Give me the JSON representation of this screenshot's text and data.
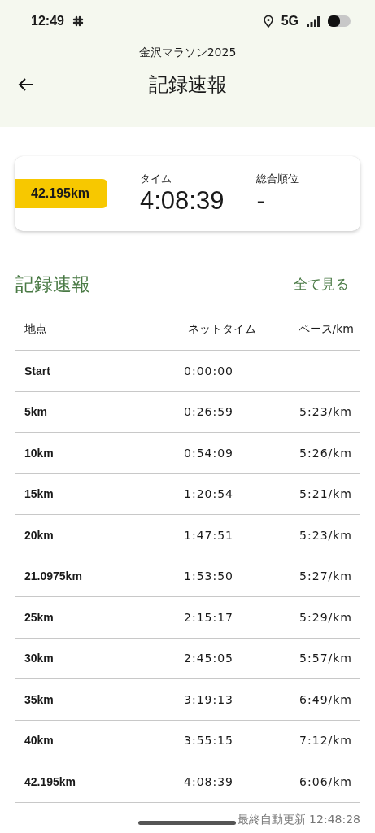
{
  "status_bar": {
    "time": "12:49",
    "network": "5G"
  },
  "header": {
    "subtitle": "金沢マラソン2025",
    "title": "記録速報"
  },
  "summary": {
    "distance": "42.195km",
    "time_label": "タイム",
    "time": "4:08:39",
    "rank_label": "総合順位",
    "rank": "-"
  },
  "section": {
    "title": "記録速報",
    "link": "全て見る"
  },
  "table": {
    "columns": [
      "地点",
      "ネットタイム",
      "ペース/km"
    ],
    "rows": [
      {
        "point": "Start",
        "net_time": "0:00:00"
      },
      {
        "point": "5km",
        "net_time": "0:26:59",
        "pace": "5:23/km"
      },
      {
        "point": "10km",
        "net_time": "0:54:09",
        "pace": "5:26/km"
      },
      {
        "point": "15km",
        "net_time": "1:20:54",
        "pace": "5:21/km"
      },
      {
        "point": "20km",
        "net_time": "1:47:51",
        "pace": "5:23/km"
      },
      {
        "point": "21.0975km",
        "net_time": "1:53:50",
        "pace": "5:27/km"
      },
      {
        "point": "25km",
        "net_time": "2:15:17",
        "pace": "5:29/km"
      },
      {
        "point": "30km",
        "net_time": "2:45:05",
        "pace": "5:57/km"
      },
      {
        "point": "35km",
        "net_time": "3:19:13",
        "pace": "6:49/km"
      },
      {
        "point": "40km",
        "net_time": "3:55:15",
        "pace": "7:12/km"
      },
      {
        "point": "42.195km",
        "net_time": "4:08:39",
        "pace": "6:06/km"
      }
    ]
  },
  "footer": {
    "updated": "最終自動更新 12:48:28"
  }
}
